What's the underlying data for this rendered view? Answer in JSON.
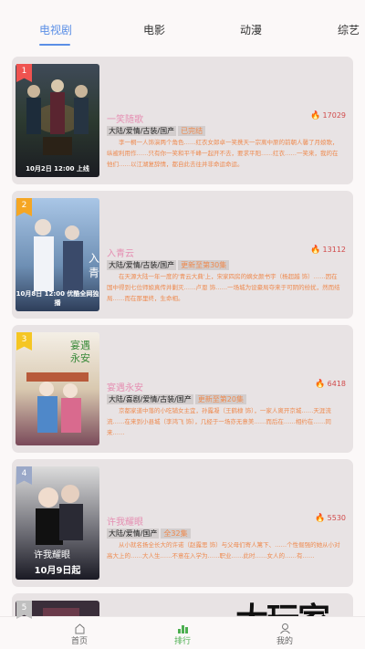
{
  "tabs": [
    {
      "label": "电视剧",
      "active": true
    },
    {
      "label": "电影",
      "active": false
    },
    {
      "label": "动漫",
      "active": false
    },
    {
      "label": "综艺",
      "active": false
    }
  ],
  "items": [
    {
      "rank": "1",
      "rank_color": "#ef5350",
      "title": "一笑随歌",
      "heat": "17029",
      "tags": "大陆/爱情/古装/国产",
      "status": "已完结",
      "poster_caption": "10月2日 12:00 上线",
      "desc": "李一桐一人饰演两个角色……红衣女郎卓一笑携天一宗离中原的前朝人馨了月娘歌，纵被利用作……只有你一笑和平千峰一起开不去，要求平阳……红衣……一笑来，我的在他们……以江湖复辞情，都自此去往并非命运命运。"
    },
    {
      "rank": "2",
      "rank_color": "#f5a623",
      "title": "入青云",
      "heat": "13112",
      "tags": "大陆/爱情/古装/国产",
      "status": "更新至第30集",
      "poster_caption": "10月8日 12:00 优酷全网独播",
      "desc": "在天源大陆一年一度的'青云大典'上，宋家四房的嫡女颜书宇（杨超越 饰）……因在国中得到七位师娘真传并剿灭……卢恩 饰……一场城为设豪局夺来于可阴的纷扰，然而结局……而在那里终，生命相。"
    },
    {
      "rank": "3",
      "rank_color": "#f5c623",
      "title": "宴遇永安",
      "heat": "6418",
      "tags": "大陆/喜剧/爱情/古装/国产",
      "status": "更新至第20集",
      "poster_caption": "",
      "desc": "京都家道中落的小吃铺女主宜，孙露凝（王鹤棣 饰），一家人离开京城……天涯流流……在来到小县城（李鸿飞 饰），几经于一场亦无意美……而后在……相约在……同来……"
    },
    {
      "rank": "4",
      "rank_color": "#9aa8c8",
      "title": "许我耀眼",
      "heat": "5530",
      "tags": "大陆/爱情/国产",
      "status": "全32集",
      "poster_caption": "10月9日起",
      "desc": "从小就名扬全长大的许诺（赵露思 饰）与父母们寄人篱下、……个性倔强的她从小对高大上的……大人生……不意在入学为……职业……此时……女人的……有……"
    },
    {
      "rank": "5",
      "rank_color": "#c0c0c0",
      "title": "",
      "heat": "",
      "tags": "",
      "status": "",
      "poster_caption": "",
      "desc": ""
    }
  ],
  "bottom_nav": [
    {
      "label": "首页",
      "icon": "home-icon",
      "active": false
    },
    {
      "label": "排行",
      "icon": "ranking-icon",
      "active": true
    },
    {
      "label": "我的",
      "icon": "user-icon",
      "active": false
    }
  ],
  "watermark": "大玩家"
}
